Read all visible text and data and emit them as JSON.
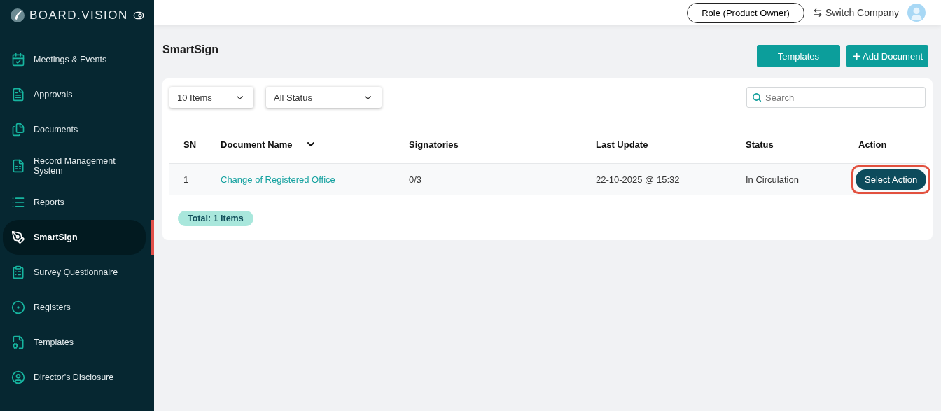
{
  "brand": "BOARD.VISION",
  "sidebar": {
    "items": [
      {
        "label": "Meetings & Events",
        "selected": false
      },
      {
        "label": "Approvals",
        "selected": false
      },
      {
        "label": "Documents",
        "selected": false
      },
      {
        "label": "Record Management System",
        "selected": false
      },
      {
        "label": "Reports",
        "selected": false
      },
      {
        "label": "SmartSign",
        "selected": true
      },
      {
        "label": "Survey Questionnaire",
        "selected": false
      },
      {
        "label": "Registers",
        "selected": false
      },
      {
        "label": "Templates",
        "selected": false
      },
      {
        "label": "Director's Disclosure",
        "selected": false
      }
    ]
  },
  "header": {
    "role": "Role (Product Owner)",
    "switch": "Switch Company"
  },
  "page_title": "SmartSign",
  "actions": [
    {
      "label": "Templates",
      "kind": "plain"
    },
    {
      "label": "Add Document",
      "kind": "add"
    }
  ],
  "filters": [
    {
      "value": "10 Items"
    },
    {
      "value": "All Status"
    }
  ],
  "search": {
    "placeholder": "Search"
  },
  "table": {
    "columns": [
      {
        "label": "SN",
        "sortable": false
      },
      {
        "label": "Document Name",
        "sortable": true
      },
      {
        "label": "Signatories",
        "sortable": false
      },
      {
        "label": "Last Update",
        "sortable": false
      },
      {
        "label": "Status",
        "sortable": false
      },
      {
        "label": "Action",
        "sortable": false
      }
    ],
    "rows": [
      {
        "sn": "1",
        "name": "Change of Registered Office",
        "signatories": "0/3",
        "updated": "22-10-2025 @ 15:32",
        "status": "In Circulation",
        "action": "Select Action",
        "highlighted": true
      }
    ]
  },
  "total": "Total: 1 Items"
}
